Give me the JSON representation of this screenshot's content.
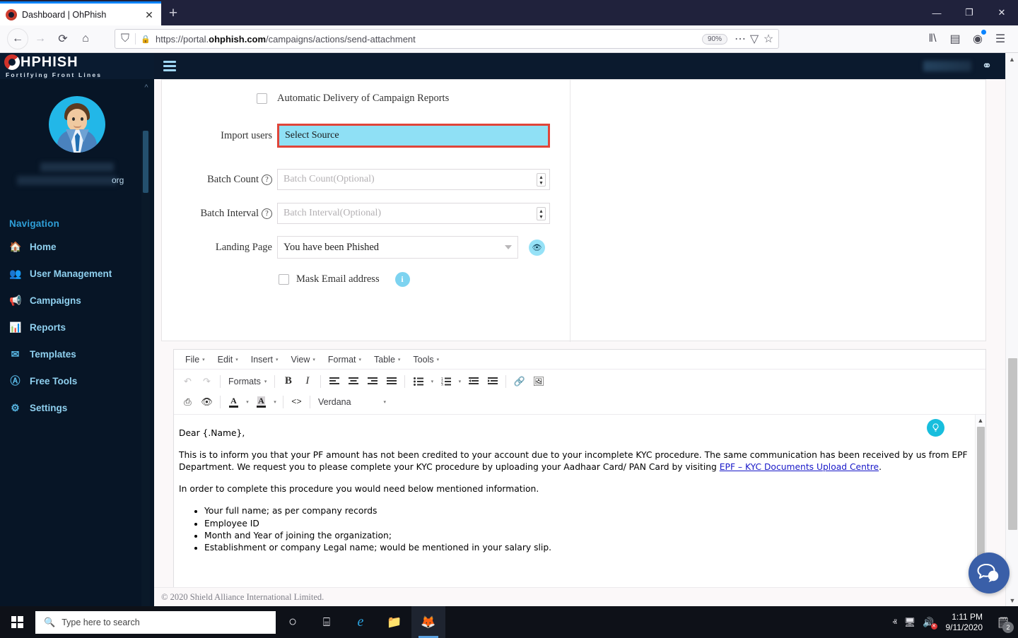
{
  "browser": {
    "tab_title": "Dashboard | OhPhish",
    "tab_close": "✕",
    "new_tab": "+",
    "window_minimize": "—",
    "window_maximize": "❐",
    "window_close": "✕",
    "back": "←",
    "forward": "→",
    "reload": "⟳",
    "home": "⌂",
    "shield_icon": "⛉",
    "lock_icon": "🔒",
    "url_prefix": "https://portal.",
    "url_domain": "ohphish.com",
    "url_path": "/campaigns/actions/send-attachment",
    "zoom_level": "90%",
    "page_actions": "⋯",
    "save_to_pocket": "▽",
    "bookmark_star": "☆",
    "library": "‖\\",
    "sidebars": "▤",
    "account": "◉",
    "app_menu": "☰"
  },
  "app": {
    "brand_name": "HPHISH",
    "brand_tagline": "Fortifying Front Lines",
    "topbar_user_icon": "person-icon",
    "menu_toggle": "hamburger-icon",
    "profile_email_tail": "org",
    "nav_header": "Navigation",
    "nav_items": [
      {
        "label": "Home",
        "icon": "🏠",
        "has_children": false,
        "caret": ""
      },
      {
        "label": "User Management",
        "icon": "👥",
        "has_children": true,
        "caret": "›"
      },
      {
        "label": "Campaigns",
        "icon": "📢",
        "has_children": true,
        "caret": "›"
      },
      {
        "label": "Reports",
        "icon": "📊",
        "has_children": true,
        "caret": "›"
      },
      {
        "label": "Templates",
        "icon": "✉",
        "has_children": true,
        "caret": "›"
      },
      {
        "label": "Free Tools",
        "icon": "Ⓐ",
        "has_children": true,
        "caret": "›"
      },
      {
        "label": "Settings",
        "icon": "⚙",
        "has_children": false,
        "caret": ""
      }
    ],
    "footer": "© 2020 Shield Alliance International Limited."
  },
  "form": {
    "auto_delivery_label": "Automatic Delivery of Campaign Reports",
    "auto_delivery_checked": false,
    "import_users_label": "Import users",
    "import_users_value": "Select Source",
    "import_users_highlight_color": "#e0453a",
    "import_users_fill_color": "#8fe0f5",
    "batch_count_label": "Batch Count",
    "batch_count_placeholder": "Batch Count(Optional)",
    "batch_interval_label": "Batch Interval",
    "batch_interval_placeholder": "Batch Interval(Optional)",
    "help_marker": "?",
    "spinner_up": "▲",
    "spinner_down": "▼",
    "landing_page_label": "Landing Page",
    "landing_page_value": "You have been Phished",
    "preview_icon": "👁",
    "mask_email_label": "Mask Email address",
    "mask_email_checked": false,
    "info_icon": "i"
  },
  "editor": {
    "menus": [
      "File",
      "Edit",
      "Insert",
      "View",
      "Format",
      "Table",
      "Tools"
    ],
    "menu_caret": "▾",
    "toolbar_row1": [
      {
        "name": "undo-icon",
        "glyph": "↶",
        "disabled": true
      },
      {
        "name": "redo-icon",
        "glyph": "↷",
        "disabled": true
      },
      {
        "name": "formats-label",
        "glyph": "Formats",
        "disabled": false
      },
      {
        "name": "bold-icon",
        "glyph": "B",
        "disabled": false
      },
      {
        "name": "italic-icon",
        "glyph": "I",
        "disabled": false
      },
      {
        "name": "align-left-icon",
        "glyph": "≡",
        "disabled": false
      },
      {
        "name": "align-center-icon",
        "glyph": "≡",
        "disabled": false
      },
      {
        "name": "align-right-icon",
        "glyph": "≡",
        "disabled": false
      },
      {
        "name": "align-justify-icon",
        "glyph": "≡",
        "disabled": false
      },
      {
        "name": "bullet-list-icon",
        "glyph": "☰",
        "disabled": false
      },
      {
        "name": "numbered-list-icon",
        "glyph": "☰",
        "disabled": false
      },
      {
        "name": "outdent-icon",
        "glyph": "⇤",
        "disabled": false
      },
      {
        "name": "indent-icon",
        "glyph": "⇥",
        "disabled": false
      },
      {
        "name": "link-icon",
        "glyph": "🔗",
        "disabled": false
      },
      {
        "name": "image-icon",
        "glyph": "🖼",
        "disabled": false
      }
    ],
    "toolbar_row2": [
      {
        "name": "print-icon",
        "glyph": "⎙",
        "disabled": false
      },
      {
        "name": "preview-icon",
        "glyph": "👁",
        "disabled": false
      },
      {
        "name": "text-color-icon",
        "glyph": "A",
        "disabled": false
      },
      {
        "name": "background-color-icon",
        "glyph": "A",
        "disabled": false
      },
      {
        "name": "source-code-icon",
        "glyph": "<>",
        "disabled": false
      }
    ],
    "font_family": "Verdana",
    "dropdown_caret": "▾",
    "scroll_up": "▲",
    "bulb_icon": "💡",
    "body": {
      "greeting": "Dear {.Name},",
      "paragraph1_part1": "This is to inform you that your PF amount has not been credited to your account due to your incomplete KYC procedure. The same communication has been received by us from EPF Department. We request you to please complete your KYC procedure by uploading your Aadhaar Card/ PAN Card by visiting ",
      "paragraph1_link": "EPF – KYC Documents Upload Centre",
      "paragraph1_part2": ".",
      "paragraph2": " In order to complete this procedure you would need below mentioned information.",
      "bullets": [
        "Your full name; as per company records",
        "Employee ID",
        "Month and Year of joining the organization;",
        "Establishment or company Legal name; would be mentioned in your salary slip."
      ]
    }
  },
  "chat": {
    "icon": "chat-bubbles-icon"
  },
  "taskbar": {
    "start": "windows-logo-icon",
    "search_placeholder": "Type here to search",
    "search_icon": "🔍",
    "cortana_icon": "○",
    "taskview_icon": "⌸",
    "edge_icon": "e",
    "explorer_icon": "📁",
    "firefox_icon": "🦊",
    "tray_chevron": "ⱏ",
    "network_icon": "🖥",
    "volume_icon": "🔊",
    "volume_muted": true,
    "time": "1:11 PM",
    "date": "9/11/2020",
    "notification_icon": "🗒",
    "notification_count": "2"
  }
}
